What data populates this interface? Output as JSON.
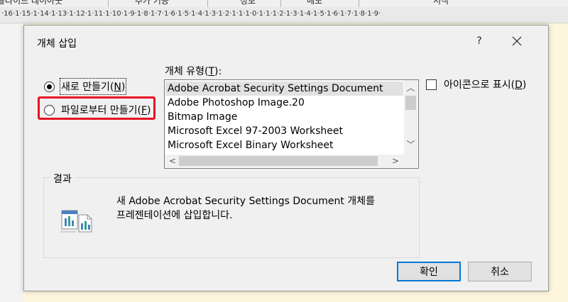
{
  "top_tabs": [
    "슬라이드 레이아웃",
    "추가 기능",
    "정보",
    "메모",
    "서식"
  ],
  "ruler_text": "·16·1·15·1·14·1·13·1·12·1·11·1·10·1·9·1·8·1·7·1·6·1·5·1·4·1·3·1·2·1·1·1·0·1·1·1·2·1·3·1·4·1·5·1·6·1·7·1·8·1·9·",
  "dialog": {
    "title": "개체 삽입",
    "help": "?",
    "options": {
      "create_new": {
        "label": "새로 만들기",
        "shortcut": "N"
      },
      "create_from_file": {
        "label": "파일로부터 만들기",
        "shortcut": "F"
      }
    },
    "object_type": {
      "label": "개체 유형",
      "shortcut": "T"
    },
    "object_types": [
      "Adobe Acrobat Security Settings Document",
      "Adobe Photoshop Image.20",
      "Bitmap Image",
      "Microsoft Excel 97-2003 Worksheet",
      "Microsoft Excel Binary Worksheet"
    ],
    "selected_type_index": 0,
    "display_as_icon": {
      "label": "아이콘으로 표시",
      "shortcut": "D",
      "checked": false
    },
    "result": {
      "label": "결과",
      "line1": "새 Adobe Acrobat Security Settings Document 개체를",
      "line2": "프레젠테이션에 삽입합니다."
    },
    "ok_label": "확인",
    "cancel_label": "취소"
  },
  "colors": {
    "highlight": "#e81123",
    "default_button_border": "#0078d7",
    "selection": "#e1e1e1"
  }
}
